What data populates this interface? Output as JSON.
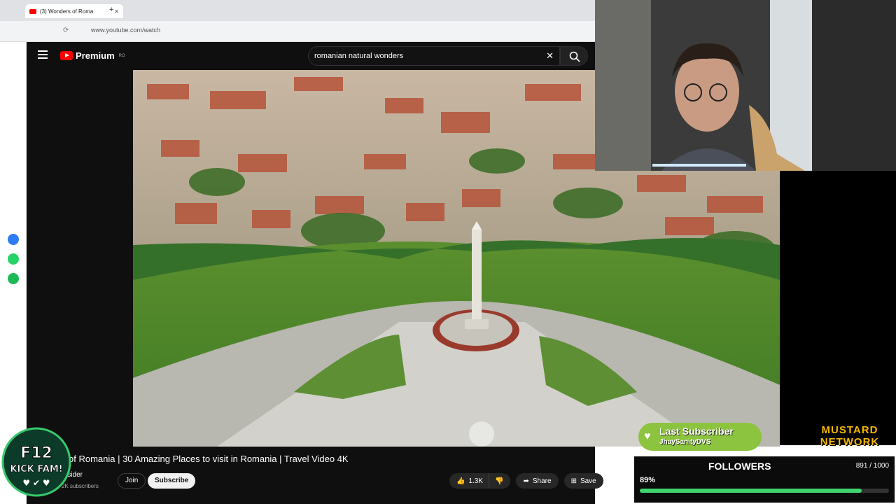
{
  "browser": {
    "tab_title": "(3) Wonders of Roma",
    "new_tab": "+",
    "url": "www.youtube.com/watch"
  },
  "youtube": {
    "logo_text": "Premium",
    "logo_region": "RO",
    "search_query": "romanian natural wonders"
  },
  "video": {
    "title": "of Romania | 30 Amazing Places to visit in Romania | Travel Video 4K",
    "channel": "Insider",
    "subscribers": "2K subscribers",
    "join_label": "Join",
    "subscribe_label": "Subscribe",
    "likes": "1.3K",
    "share_label": "Share",
    "save_label": "Save"
  },
  "overlays": {
    "f12_line1": "F12",
    "f12_line2": "KICK FAM!",
    "last_subscriber_title": "Last Subscriber",
    "last_subscriber_name": "JhaySanityDVS",
    "brand_line1": "MUSTARD",
    "brand_line2": "NETWORK",
    "followers_title": "FOLLOWERS",
    "followers_count": "891 / 1000",
    "followers_percent_label": "89%",
    "followers_progress": 0.89
  },
  "colors": {
    "yt_red": "#ff0000",
    "accent_green": "#3fd46e",
    "mustard": "#f5b800",
    "last_sub_green": "#8cc33f"
  },
  "rail_icons": [
    "messenger-icon",
    "whatsapp-icon",
    "spotify-icon"
  ]
}
